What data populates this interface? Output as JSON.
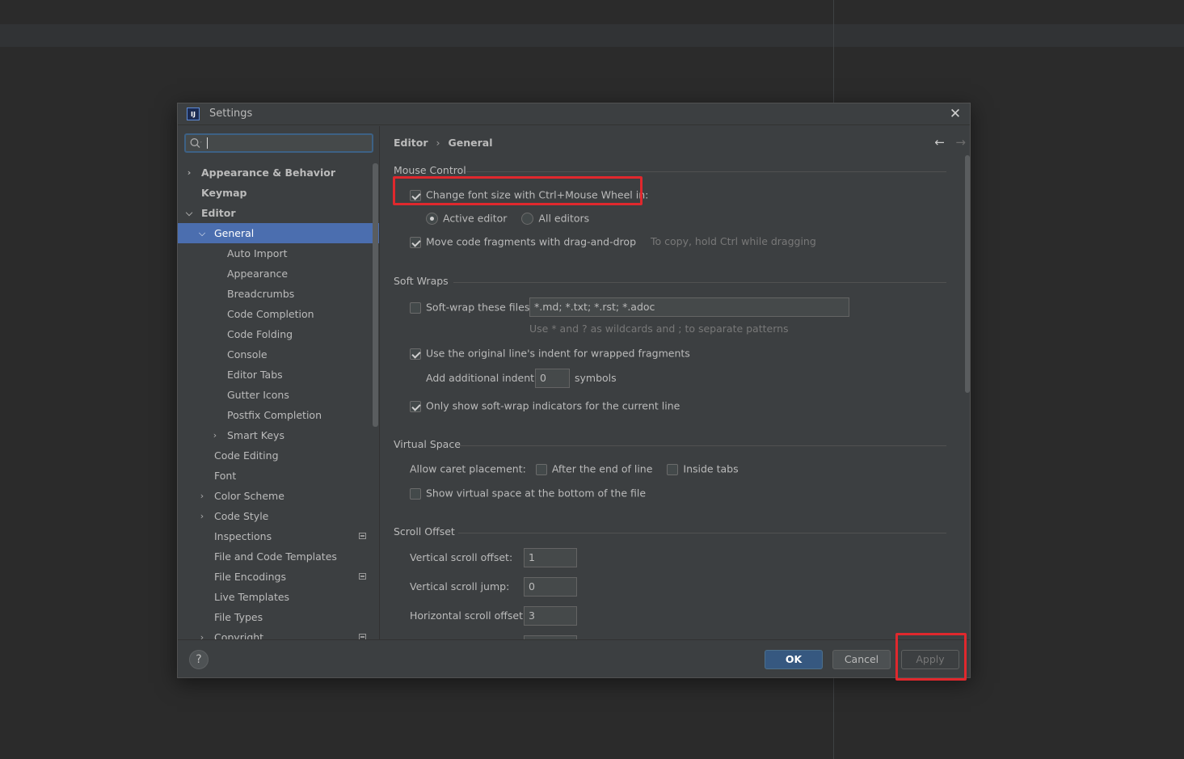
{
  "dialog": {
    "title": "Settings"
  },
  "search": {
    "placeholder": ""
  },
  "tree": [
    {
      "label": "Appearance & Behavior",
      "bold": true,
      "arrow": "right",
      "indent": 0
    },
    {
      "label": "Keymap",
      "bold": true,
      "arrow": "",
      "indent": 0
    },
    {
      "label": "Editor",
      "bold": true,
      "arrow": "down",
      "indent": 0
    },
    {
      "label": "General",
      "bold": false,
      "arrow": "down",
      "indent": 1,
      "selected": true
    },
    {
      "label": "Auto Import",
      "indent": 2
    },
    {
      "label": "Appearance",
      "indent": 2
    },
    {
      "label": "Breadcrumbs",
      "indent": 2
    },
    {
      "label": "Code Completion",
      "indent": 2
    },
    {
      "label": "Code Folding",
      "indent": 2
    },
    {
      "label": "Console",
      "indent": 2
    },
    {
      "label": "Editor Tabs",
      "indent": 2
    },
    {
      "label": "Gutter Icons",
      "indent": 2
    },
    {
      "label": "Postfix Completion",
      "indent": 2
    },
    {
      "label": "Smart Keys",
      "arrow": "right",
      "indent": 2
    },
    {
      "label": "Code Editing",
      "indent": 1
    },
    {
      "label": "Font",
      "indent": 1
    },
    {
      "label": "Color Scheme",
      "arrow": "right",
      "indent": 1
    },
    {
      "label": "Code Style",
      "arrow": "right",
      "indent": 1
    },
    {
      "label": "Inspections",
      "indent": 1,
      "icon": true
    },
    {
      "label": "File and Code Templates",
      "indent": 1
    },
    {
      "label": "File Encodings",
      "indent": 1,
      "icon": true
    },
    {
      "label": "Live Templates",
      "indent": 1
    },
    {
      "label": "File Types",
      "indent": 1
    },
    {
      "label": "Copyright",
      "arrow": "right",
      "indent": 1,
      "icon": true
    }
  ],
  "breadcrumb": {
    "parent": "Editor",
    "sep": "›",
    "current": "General"
  },
  "nav": {
    "back": "←",
    "forward": "→"
  },
  "mouse": {
    "title": "Mouse Control",
    "change_font": "Change font size with Ctrl+Mouse Wheel in:",
    "change_font_checked": true,
    "active_editor": "Active editor",
    "all_editors": "All editors",
    "drag_drop": "Move code fragments with drag-and-drop",
    "drag_drop_checked": true,
    "drag_hint": "To copy, hold Ctrl while dragging"
  },
  "soft_wraps": {
    "title": "Soft Wraps",
    "soft_wrap_files": "Soft-wrap these files:",
    "soft_wrap_checked": false,
    "patterns": "*.md; *.txt; *.rst; *.adoc",
    "patterns_hint": "Use * and ? as wildcards and ; to separate patterns",
    "use_indent": "Use the original line's indent for wrapped fragments",
    "use_indent_checked": true,
    "add_indent": "Add additional indent:",
    "add_indent_value": "0",
    "symbols": "symbols",
    "only_show": "Only show soft-wrap indicators for the current line",
    "only_show_checked": true
  },
  "virtual_space": {
    "title": "Virtual Space",
    "allow_caret": "Allow caret placement:",
    "after_end": "After the end of line",
    "inside_tabs": "Inside tabs",
    "show_virtual": "Show virtual space at the bottom of the file"
  },
  "scroll": {
    "title": "Scroll Offset",
    "vertical_offset": "Vertical scroll offset:",
    "vertical_offset_value": "1",
    "vertical_jump": "Vertical scroll jump:",
    "vertical_jump_value": "0",
    "horizontal_offset": "Horizontal scroll offset:",
    "horizontal_offset_value": "3"
  },
  "buttons": {
    "help": "?",
    "ok": "OK",
    "cancel": "Cancel",
    "apply": "Apply"
  },
  "colors": {
    "accent": "#4b6eaf",
    "highlight": "#e0282d",
    "ok_button": "#365880"
  }
}
